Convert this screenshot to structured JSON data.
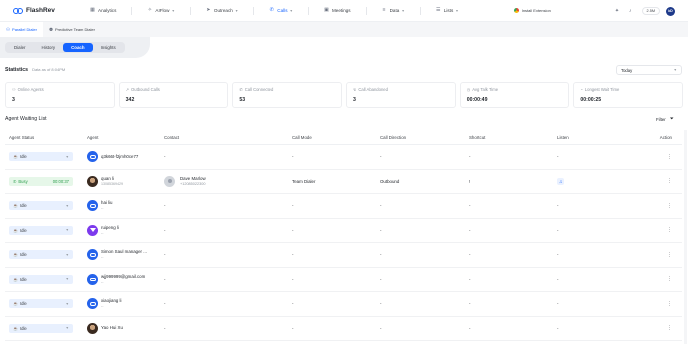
{
  "app": {
    "brand": "FlashRev"
  },
  "nav": {
    "items": [
      {
        "label": "Analytics",
        "icon": "chart-icon"
      },
      {
        "label": "AIFlow",
        "icon": "flow-icon",
        "dropdown": true
      },
      {
        "label": "Outreach",
        "icon": "send-icon",
        "dropdown": true
      },
      {
        "label": "Calls",
        "icon": "phone-icon",
        "dropdown": true,
        "active": true
      },
      {
        "label": "Meetings",
        "icon": "calendar-icon"
      },
      {
        "label": "Data",
        "icon": "database-icon",
        "dropdown": true
      },
      {
        "label": "Lists",
        "icon": "list-icon",
        "dropdown": true
      }
    ],
    "extension": "Install Extension",
    "credits": "2.5M",
    "avatar": "kD"
  },
  "subtabs": [
    {
      "label": "Parallel Dialer",
      "active": true
    },
    {
      "label": "Predictive Team Dialer",
      "active": false
    }
  ],
  "segments": [
    {
      "label": "Dialer",
      "active": false
    },
    {
      "label": "History",
      "active": false
    },
    {
      "label": "Coach",
      "active": true
    },
    {
      "label": "Insights",
      "active": false
    }
  ],
  "stats": {
    "title": "Statistics",
    "subtitle": "Data as of 8:04PM",
    "range": "Today",
    "cards": [
      {
        "label": "Online Agents",
        "value": "3"
      },
      {
        "label": "Outbound Calls",
        "value": "342"
      },
      {
        "label": "Call Connected",
        "value": "53"
      },
      {
        "label": "Call Abandoned",
        "value": "3"
      },
      {
        "label": "Avg Talk Time",
        "value": "00:00:49"
      },
      {
        "label": "Longest Wait Time",
        "value": "00:00:25"
      }
    ]
  },
  "list": {
    "title": "Agent Waiting List",
    "filter_label": "Filter",
    "columns": [
      "Agent Status",
      "Agent",
      "Contact",
      "Call Mode",
      "Call Direction",
      "Shortcut",
      "Listen",
      "Action"
    ],
    "rows": [
      {
        "status": "Idle",
        "status_type": "idle",
        "timer": "",
        "agent": "q3k66t-f2jmh0ce77",
        "agent_sub": "",
        "avatar": "blue",
        "contact_name": "-",
        "contact_phone": "",
        "call_mode": "-",
        "call_direction": "-",
        "shortcut": "-",
        "listen": "-"
      },
      {
        "status": "Busy",
        "status_type": "busy",
        "timer": "00:00:37",
        "agent": "quan li",
        "agent_sub": "13085369429",
        "avatar": "photo",
        "contact_name": "Dave Marlow",
        "contact_phone": "+12085022300",
        "call_mode": "Team Dialer",
        "call_direction": "Outbound",
        "shortcut": "!",
        "listen": "listen-icon"
      },
      {
        "status": "Idle",
        "status_type": "idle",
        "timer": "",
        "agent": "hai liu",
        "agent_sub": "--",
        "avatar": "blue",
        "contact_name": "-",
        "contact_phone": "",
        "call_mode": "-",
        "call_direction": "-",
        "shortcut": "-",
        "listen": "-"
      },
      {
        "status": "Idle",
        "status_type": "idle",
        "timer": "",
        "agent": "ruipeng li",
        "agent_sub": "--",
        "avatar": "purple",
        "contact_name": "-",
        "contact_phone": "",
        "call_mode": "-",
        "call_direction": "-",
        "shortcut": "-",
        "listen": "-"
      },
      {
        "status": "Idle",
        "status_type": "idle",
        "timer": "",
        "agent": "Simon Saul manager ...",
        "agent_sub": "--",
        "avatar": "blue",
        "contact_name": "-",
        "contact_phone": "",
        "call_mode": "-",
        "call_direction": "-",
        "shortcut": "-",
        "listen": "-"
      },
      {
        "status": "Idle",
        "status_type": "idle",
        "timer": "",
        "agent": "wjj999999@gmail.com",
        "agent_sub": "--",
        "avatar": "blue",
        "contact_name": "-",
        "contact_phone": "",
        "call_mode": "-",
        "call_direction": "-",
        "shortcut": "-",
        "listen": "-"
      },
      {
        "status": "Idle",
        "status_type": "idle",
        "timer": "",
        "agent": "xiaojiang li",
        "agent_sub": "--",
        "avatar": "blue",
        "contact_name": "-",
        "contact_phone": "",
        "call_mode": "-",
        "call_direction": "-",
        "shortcut": "-",
        "listen": "-"
      },
      {
        "status": "Idle",
        "status_type": "idle",
        "timer": "",
        "agent": "Yao Hui Xu",
        "agent_sub": "",
        "avatar": "photo",
        "contact_name": "-",
        "contact_phone": "",
        "call_mode": "-",
        "call_direction": "-",
        "shortcut": "-",
        "listen": "-"
      }
    ]
  }
}
